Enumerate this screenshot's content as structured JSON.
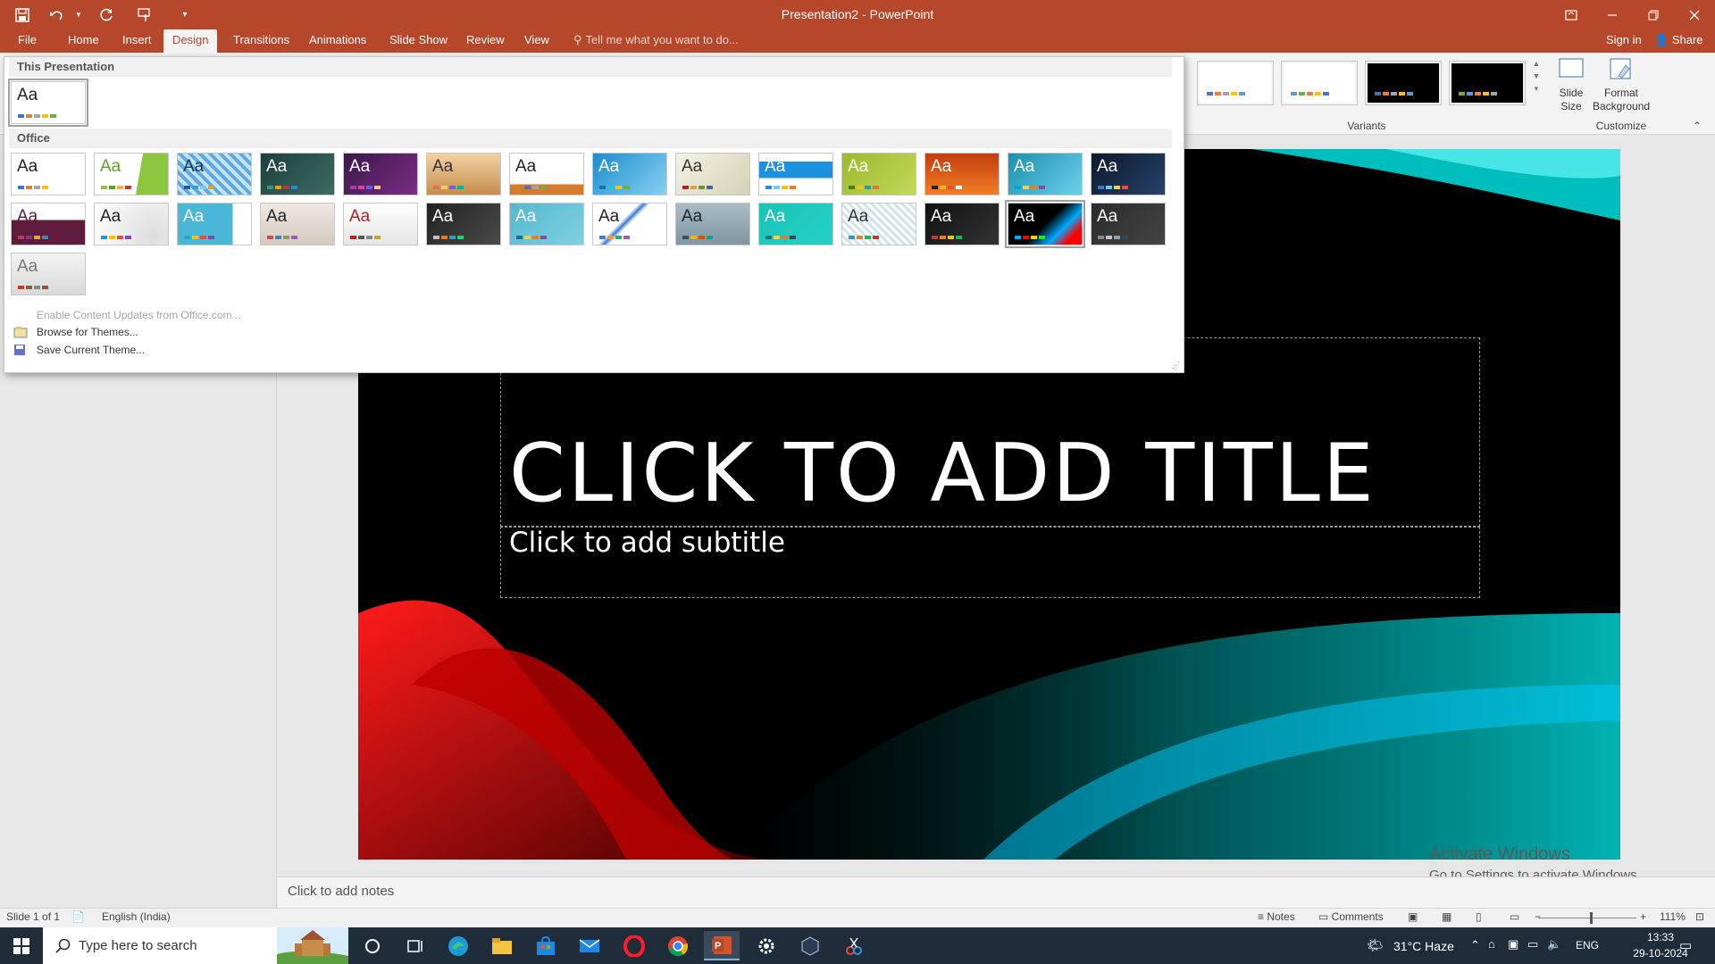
{
  "window": {
    "title": "Presentation2 - PowerPoint",
    "controls": [
      "ribbon-display-icon",
      "minimize-icon",
      "restore-icon",
      "close-icon"
    ]
  },
  "qat": {
    "icons": [
      "save-icon",
      "undo-icon",
      "undo-dropdown-icon",
      "redo-icon",
      "touch-mode-icon",
      "customize-qat-icon"
    ]
  },
  "tabs": [
    "File",
    "Home",
    "Insert",
    "Design",
    "Transitions",
    "Animations",
    "Slide Show",
    "Review",
    "View"
  ],
  "active_tab": "Design",
  "tell_me": "Tell me what you want to do...",
  "account": {
    "signin": "Sign in",
    "share": "Share"
  },
  "ribbon": {
    "variants_label": "Variants",
    "customize_label": "Customize",
    "slide_size": "Slide Size",
    "format_background": "Format Background"
  },
  "gallery": {
    "this_presentation": "This Presentation",
    "office": "Office",
    "aa": "Aa",
    "menu": {
      "enable_updates": "Enable Content Updates from Office.com...",
      "browse": "Browse for Themes...",
      "save": "Save Current Theme..."
    }
  },
  "slide": {
    "title": "CLICK TO ADD TITLE",
    "subtitle": "Click to add subtitle"
  },
  "watermark": {
    "line1": "Activate Windows",
    "line2": "Go to Settings to activate Windows."
  },
  "notes_placeholder": "Click to add notes",
  "status": {
    "slide": "Slide 1 of 1",
    "language": "English (India)",
    "notes": "Notes",
    "comments": "Comments",
    "zoom": "111%"
  },
  "taskbar": {
    "search_placeholder": "Type here to search",
    "weather": "31°C  Haze",
    "lang": "ENG",
    "time": "13:33",
    "date": "29-10-2024"
  }
}
